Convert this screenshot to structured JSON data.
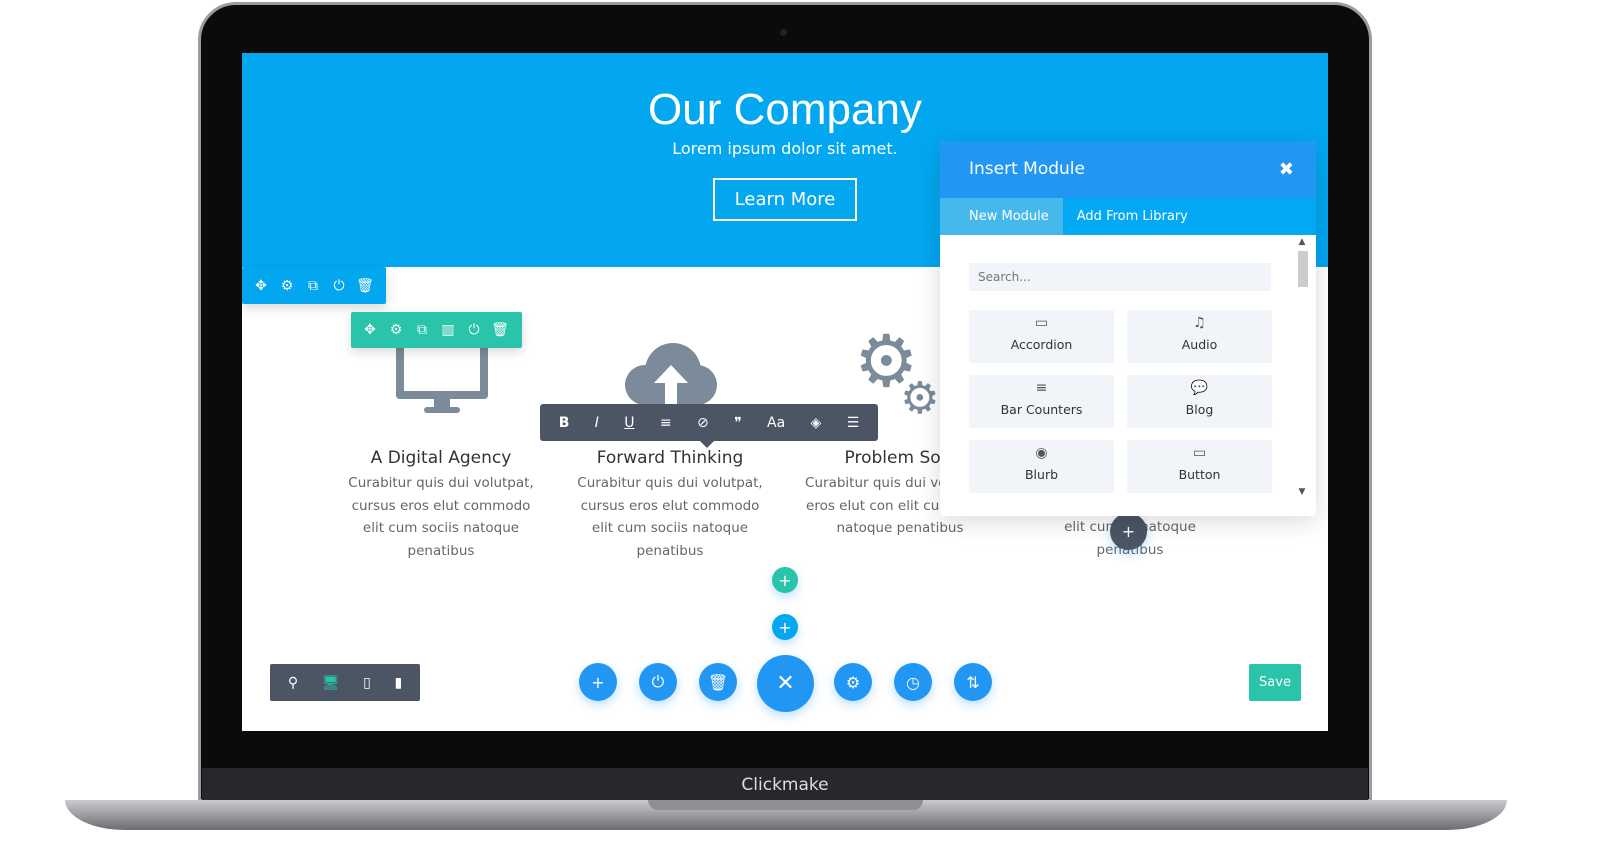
{
  "device": {
    "brand": "Clickmake"
  },
  "hero": {
    "title": "Our Company",
    "subtitle": "Lorem ipsum dolor sit amet.",
    "button": "Learn More"
  },
  "columns": [
    {
      "title": "A Digital Agency",
      "body": "Curabitur quis dui volutpat, cursus eros elut commodo elit cum sociis natoque penatibus",
      "icon": "monitor-icon"
    },
    {
      "title": "Forward Thinking",
      "body": "Curabitur quis dui volutpat, cursus eros elut commodo elit cum sociis natoque penatibus",
      "icon": "cloud-upload-icon"
    },
    {
      "title": "Problem Solv",
      "body": "Curabitur quis dui vo cursus eros elut con elit cum sociis natoque penatibus",
      "icon": "gears-icon"
    },
    {
      "title": "",
      "body": "elit cum     natoque penatibus",
      "icon": ""
    }
  ],
  "insert_module": {
    "title": "Insert Module",
    "close": "✖",
    "tabs": [
      "New Module",
      "Add From Library"
    ],
    "search_placeholder": "Search...",
    "modules": [
      {
        "label": "Accordion",
        "icon": "▭"
      },
      {
        "label": "Audio",
        "icon": "♫"
      },
      {
        "label": "Bar Counters",
        "icon": "≡"
      },
      {
        "label": "Blog",
        "icon": "💬"
      },
      {
        "label": "Blurb",
        "icon": "◉"
      },
      {
        "label": "Button",
        "icon": "▭"
      }
    ]
  },
  "format_toolbar": [
    "B",
    "I",
    "U",
    "≡",
    "⊘",
    "❞",
    "Aa",
    "◈",
    "☰"
  ],
  "section_toolbar": [
    "✥",
    "⚙",
    "⧉",
    "⏻",
    "🗑"
  ],
  "row_toolbar": [
    "✥",
    "⚙",
    "⧉",
    "▥",
    "⏻",
    "🗑"
  ],
  "bottom_bar": {
    "actions": [
      "+",
      "⏻",
      "🗑",
      "✕",
      "⚙",
      "◷",
      "⇅"
    ],
    "views": [
      "⚲",
      "🖥",
      "▯",
      "▮"
    ],
    "save": "Save"
  },
  "colors": {
    "primary": "#2196f3",
    "hero": "#03a7f0",
    "green": "#29c4a9",
    "dark": "#4b5563"
  }
}
